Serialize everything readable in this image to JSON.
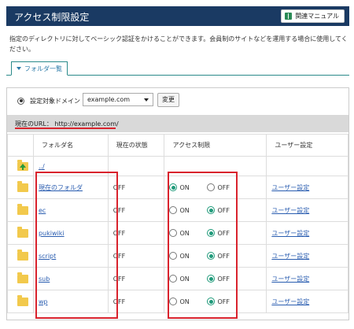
{
  "header": {
    "title": "アクセス制限設定",
    "manual_button": "関連マニュアル"
  },
  "description": "指定のディレクトリに対してベーシック認証をかけることができます。会員制のサイトなどを運用する場合に使用してください。",
  "tab": {
    "label": "フォルダ一覧"
  },
  "domain": {
    "label": "設定対象ドメイン",
    "selected": "example.com",
    "change_button": "変更"
  },
  "current_url": {
    "label": "現在のURL： http://example.com/"
  },
  "table": {
    "columns": [
      "フォルダ名",
      "現在の状態",
      "アクセス制限",
      "ユーザー設定"
    ],
    "parent_link": "../",
    "radio_on": "ON",
    "radio_off": "OFF",
    "rows": [
      {
        "name": "現在のフォルダ",
        "state": "OFF",
        "access": "ON",
        "user_link": "ユーザー設定"
      },
      {
        "name": "ec",
        "state": "OFF",
        "access": "OFF",
        "user_link": "ユーザー設定"
      },
      {
        "name": "pukiwiki",
        "state": "OFF",
        "access": "OFF",
        "user_link": "ユーザー設定"
      },
      {
        "name": "script",
        "state": "OFF",
        "access": "OFF",
        "user_link": "ユーザー設定"
      },
      {
        "name": "sub",
        "state": "OFF",
        "access": "OFF",
        "user_link": "ユーザー設定"
      },
      {
        "name": "wp",
        "state": "OFF",
        "access": "OFF",
        "user_link": "ユーザー設定"
      }
    ]
  },
  "colors": {
    "header_bg": "#1a3a63",
    "accent": "#1f9a7a",
    "highlight": "#d9232d",
    "link": "#2a5db0"
  }
}
